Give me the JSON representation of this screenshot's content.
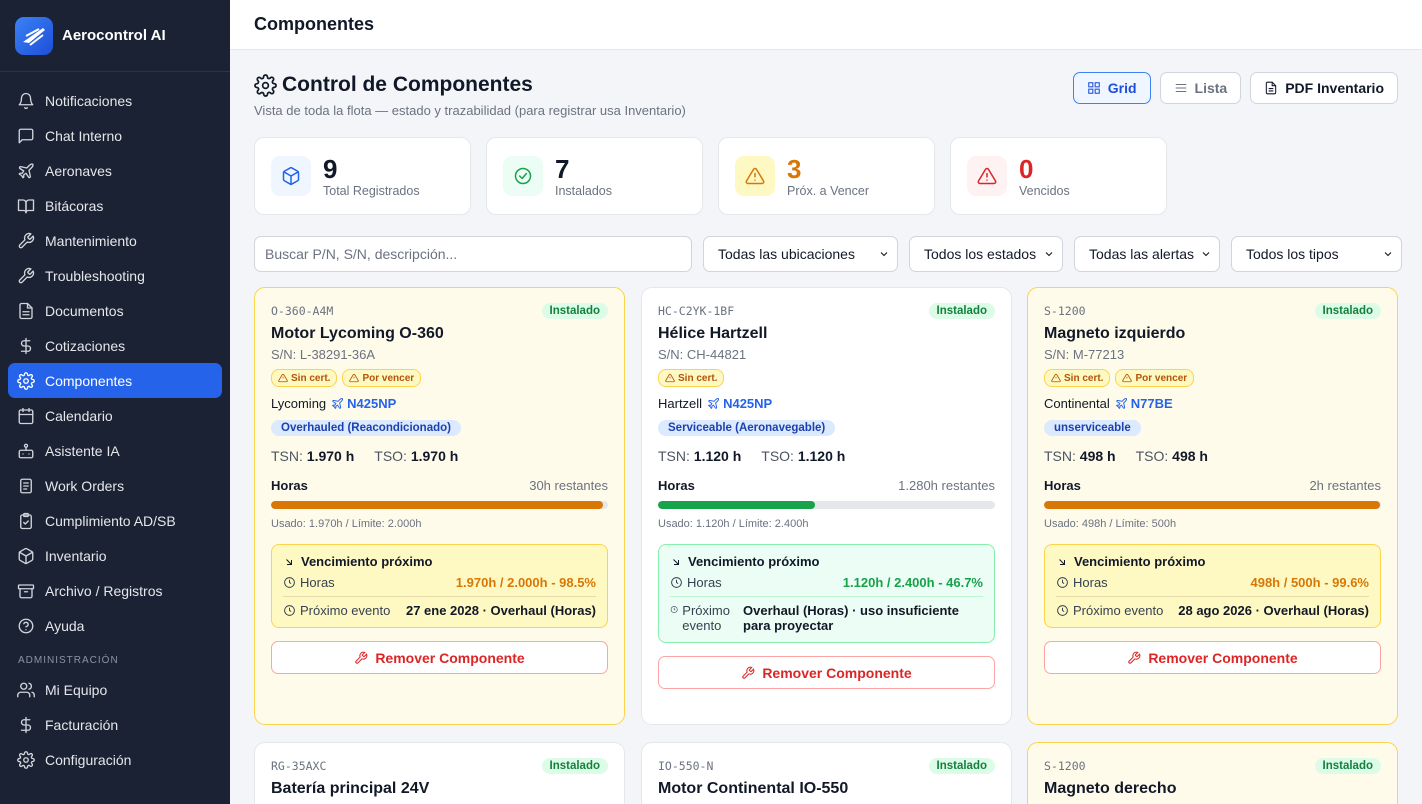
{
  "brand": {
    "name": "Aerocontrol AI"
  },
  "sidebar": {
    "items": [
      {
        "label": "Notificaciones",
        "icon": "bell-icon"
      },
      {
        "label": "Chat Interno",
        "icon": "chat-icon"
      },
      {
        "label": "Aeronaves",
        "icon": "plane-icon"
      },
      {
        "label": "Bitácoras",
        "icon": "book-icon"
      },
      {
        "label": "Mantenimiento",
        "icon": "wrench-icon"
      },
      {
        "label": "Troubleshooting",
        "icon": "wrench-icon"
      },
      {
        "label": "Documentos",
        "icon": "file-icon"
      },
      {
        "label": "Cotizaciones",
        "icon": "dollar-icon"
      },
      {
        "label": "Componentes",
        "icon": "gear-icon",
        "active": true
      },
      {
        "label": "Calendario",
        "icon": "calendar-icon"
      },
      {
        "label": "Asistente IA",
        "icon": "bot-icon"
      },
      {
        "label": "Work Orders",
        "icon": "clipboard-icon"
      },
      {
        "label": "Cumplimiento AD/SB",
        "icon": "clipboard-check-icon"
      },
      {
        "label": "Inventario",
        "icon": "box-icon"
      },
      {
        "label": "Archivo / Registros",
        "icon": "archive-icon"
      },
      {
        "label": "Ayuda",
        "icon": "help-icon"
      }
    ],
    "admin_label": "ADMINISTRACIÓN",
    "admin_items": [
      {
        "label": "Mi Equipo",
        "icon": "users-icon"
      },
      {
        "label": "Facturación",
        "icon": "dollar-icon"
      },
      {
        "label": "Configuración",
        "icon": "gear-icon"
      }
    ]
  },
  "topbar": {
    "title": "Componentes"
  },
  "page": {
    "title": "Control de Componentes",
    "subtitle": "Vista de toda la flota — estado y trazabilidad (para registrar usa Inventario)"
  },
  "view": {
    "grid": "Grid",
    "list": "Lista",
    "pdf": "PDF Inventario"
  },
  "stats": [
    {
      "value": "9",
      "label": "Total Registrados",
      "color": "#111827"
    },
    {
      "value": "7",
      "label": "Instalados",
      "color": "#111827"
    },
    {
      "value": "3",
      "label": "Próx. a Vencer",
      "color": "#d97706"
    },
    {
      "value": "0",
      "label": "Vencidos",
      "color": "#dc2626"
    }
  ],
  "filters": {
    "search_placeholder": "Buscar P/N, S/N, descripción...",
    "location": "Todas las ubicaciones",
    "status": "Todos los estados",
    "alerts": "Todas las alertas",
    "types": "Todos los tipos"
  },
  "cards": [
    {
      "pn": "O-360-A4M",
      "status": "Instalado",
      "name": "Motor Lycoming O-360",
      "sn": "S/N: L-38291-36A",
      "tags": [
        "Sin cert.",
        "Por vencer"
      ],
      "manufacturer": "Lycoming",
      "registration": "N425NP",
      "condition": "Overhauled (Reacondicionado)",
      "tsn_label": "TSN:",
      "tsn": "1.970 h",
      "tso_label": "TSO:",
      "tso": "1.970 h",
      "bar_label": "Horas",
      "remaining": "30h restantes",
      "progress": 0.985,
      "bar_color": "#d97706",
      "usage": "Usado: 1.970h / Límite: 2.000h",
      "venc_title": "Vencimiento próximo",
      "hours_label": "Horas",
      "hours_value": "1.970h / 2.000h - 98.5%",
      "hours_color": "#d97706",
      "event_label": "Próximo evento",
      "event_value": "27 ene 2028 · Overhaul (Horas)",
      "remove": "Remover Componente"
    },
    {
      "pn": "HC-C2YK-1BF",
      "status": "Instalado",
      "name": "Hélice Hartzell",
      "sn": "S/N: CH-44821",
      "tags": [
        "Sin cert."
      ],
      "manufacturer": "Hartzell",
      "registration": "N425NP",
      "condition": "Serviceable (Aeronavegable)",
      "tsn_label": "TSN:",
      "tsn": "1.120 h",
      "tso_label": "TSO:",
      "tso": "1.120 h",
      "bar_label": "Horas",
      "remaining": "1.280h restantes",
      "progress": 0.467,
      "bar_color": "#16a34a",
      "usage": "Usado: 1.120h / Límite: 2.400h",
      "venc_title": "Vencimiento próximo",
      "hours_label": "Horas",
      "hours_value": "1.120h / 2.400h - 46.7%",
      "hours_color": "#16a34a",
      "event_label": "Próximo evento",
      "event_value": "Overhaul (Horas) · uso insuficiente para proyectar",
      "remove": "Remover Componente"
    },
    {
      "pn": "S-1200",
      "status": "Instalado",
      "name": "Magneto izquierdo",
      "sn": "S/N: M-77213",
      "tags": [
        "Sin cert.",
        "Por vencer"
      ],
      "manufacturer": "Continental",
      "registration": "N77BE",
      "condition": "unserviceable",
      "tsn_label": "TSN:",
      "tsn": "498 h",
      "tso_label": "TSO:",
      "tso": "498 h",
      "bar_label": "Horas",
      "remaining": "2h restantes",
      "progress": 0.996,
      "bar_color": "#d97706",
      "usage": "Usado: 498h / Límite: 500h",
      "venc_title": "Vencimiento próximo",
      "hours_label": "Horas",
      "hours_value": "498h / 500h - 99.6%",
      "hours_color": "#d97706",
      "event_label": "Próximo evento",
      "event_value": "28 ago 2026 · Overhaul (Horas)",
      "remove": "Remover Componente"
    },
    {
      "pn": "RG-35AXC",
      "status": "Instalado",
      "name": "Batería principal 24V"
    },
    {
      "pn": "IO-550-N",
      "status": "Instalado",
      "name": "Motor Continental IO-550"
    },
    {
      "pn": "S-1200",
      "status": "Instalado",
      "name": "Magneto derecho"
    }
  ]
}
